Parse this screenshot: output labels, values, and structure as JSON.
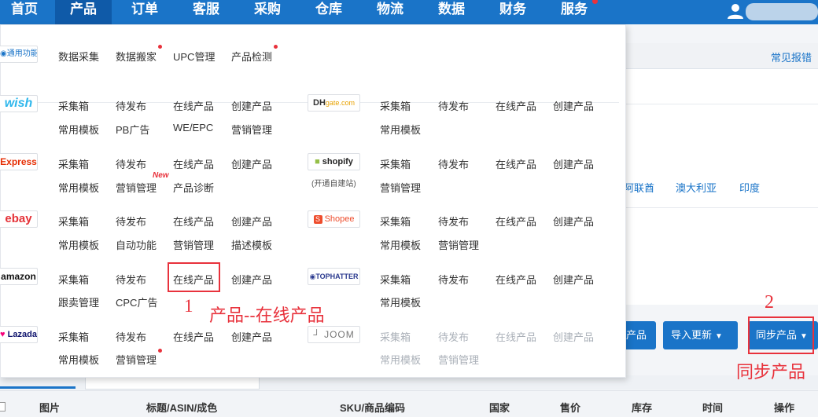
{
  "nav": {
    "items": [
      "首页",
      "产品",
      "订单",
      "客服",
      "采购",
      "仓库",
      "物流",
      "数据",
      "财务",
      "服务"
    ],
    "active": "产品"
  },
  "subbar": {
    "faq": "常见报错"
  },
  "countries": [
    "阿联酋",
    "澳大利亚",
    "印度"
  ],
  "toolbar": {
    "partial_button": "产品",
    "import_update": "导入更新",
    "sync_products": "同步产品"
  },
  "annotations": {
    "num1": "1",
    "num2": "2",
    "path_label": "产品--在线产品",
    "sync_label": "同步产品"
  },
  "table": {
    "headers": [
      "图片",
      "标题/ASIN/成色",
      "SKU/商品编码",
      "国家",
      "售价",
      "库存",
      "时间",
      "操作"
    ]
  },
  "menu": {
    "general": {
      "logo": "通用功能",
      "items": [
        "数据采集",
        "数据搬家",
        "UPC管理",
        "产品检测"
      ]
    },
    "left": [
      {
        "platform": "wish",
        "row1": [
          "采集箱",
          "待发布",
          "在线产品",
          "创建产品"
        ],
        "row2": [
          "常用模板",
          "PB广告",
          "WE/EPC",
          "营销管理"
        ]
      },
      {
        "platform": "Express",
        "row1": [
          "采集箱",
          "待发布",
          "在线产品",
          "创建产品"
        ],
        "row2": [
          "常用模板",
          "营销管理",
          "产品诊断"
        ]
      },
      {
        "platform": "ebay",
        "row1": [
          "采集箱",
          "待发布",
          "在线产品",
          "创建产品"
        ],
        "row2": [
          "常用模板",
          "自动功能",
          "营销管理",
          "描述模板"
        ]
      },
      {
        "platform": "amazon",
        "row1": [
          "采集箱",
          "待发布",
          "在线产品",
          "创建产品"
        ],
        "row2": [
          "跟卖管理",
          "CPC广告"
        ]
      },
      {
        "platform": "Lazada",
        "row1": [
          "采集箱",
          "待发布",
          "在线产品",
          "创建产品"
        ],
        "row2": [
          "常用模板",
          "营销管理"
        ]
      }
    ],
    "right": [
      {
        "platform": "DH",
        "platform_sub": "gate.com",
        "row1": [
          "采集箱",
          "待发布",
          "在线产品",
          "创建产品"
        ],
        "row2": [
          "常用模板"
        ]
      },
      {
        "platform": "shopify",
        "caption": "(开通自建站)",
        "row1": [
          "采集箱",
          "待发布",
          "在线产品",
          "创建产品"
        ],
        "row2": [
          "营销管理"
        ]
      },
      {
        "platform": "Shopee",
        "row1": [
          "采集箱",
          "待发布",
          "在线产品",
          "创建产品"
        ],
        "row2": [
          "常用模板",
          "营销管理"
        ]
      },
      {
        "platform": "TOPHATTER",
        "row1": [
          "采集箱",
          "待发布",
          "在线产品",
          "创建产品"
        ],
        "row2": [
          "常用模板"
        ]
      },
      {
        "platform": "JOOM",
        "row1": [
          "采集箱",
          "待发布",
          "在线产品",
          "创建产品"
        ],
        "row2": [
          "常用模板",
          "营销管理"
        ]
      }
    ],
    "new_tag": "New"
  },
  "colors": {
    "brand": "#1a74c8",
    "annotation": "#e8323c"
  }
}
